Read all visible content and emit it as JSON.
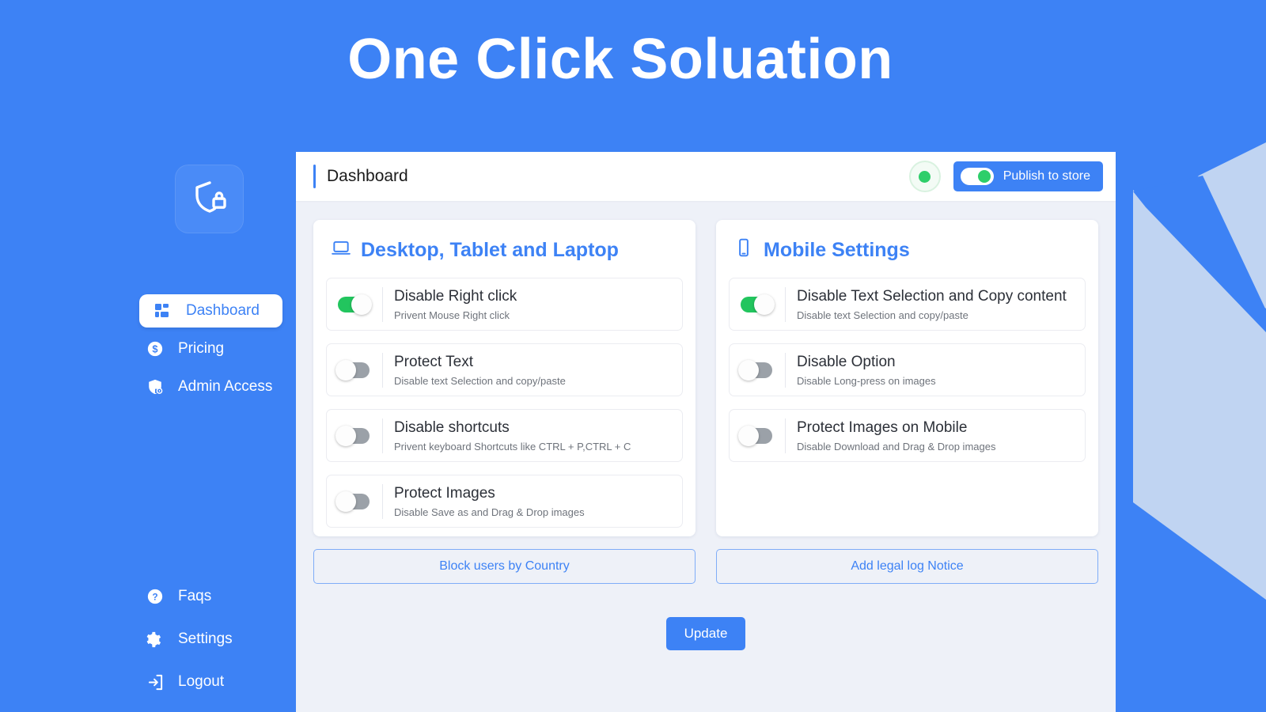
{
  "app": {
    "title": "One Click Soluation",
    "brand_color": "#3d82f5",
    "logo_icon": "shield-lock-icon"
  },
  "sidebar": {
    "top_items": [
      {
        "label": "Dashboard",
        "icon": "dashboard-grid-icon",
        "active": true
      },
      {
        "label": "Pricing",
        "icon": "dollar-circle-icon",
        "active": false
      },
      {
        "label": "Admin Access",
        "icon": "shield-user-icon",
        "active": false
      }
    ],
    "bottom_items": [
      {
        "label": "Faqs",
        "icon": "question-circle-icon"
      },
      {
        "label": "Settings",
        "icon": "gear-icon"
      },
      {
        "label": "Logout",
        "icon": "logout-arrow-icon"
      }
    ]
  },
  "topbar": {
    "title": "Dashboard",
    "status_dot_color": "#2ece6a",
    "publish_label": "Publish to store",
    "publish_toggle_on": true
  },
  "panels": [
    {
      "heading": "Desktop, Tablet and Laptop",
      "icon": "laptop-icon",
      "rows": [
        {
          "title": "Disable Right click",
          "sub": "Privent Mouse Right click",
          "on": true
        },
        {
          "title": "Protect Text",
          "sub": "Disable text Selection and copy/paste",
          "on": false
        },
        {
          "title": "Disable shortcuts",
          "sub": "Privent keyboard Shortcuts like CTRL + P,CTRL + C",
          "on": false
        },
        {
          "title": "Protect Images",
          "sub": "Disable Save as and Drag & Drop images",
          "on": false
        }
      ],
      "action_label": "Block users by Country"
    },
    {
      "heading": "Mobile Settings",
      "icon": "mobile-icon",
      "rows": [
        {
          "title": "Disable Text Selection and Copy content",
          "sub": "Disable text Selection and copy/paste",
          "on": true
        },
        {
          "title": "Disable Option",
          "sub": "Disable Long-press on images",
          "on": false
        },
        {
          "title": "Protect Images on Mobile",
          "sub": "Disable Download and Drag & Drop images",
          "on": false
        }
      ],
      "action_label": "Add legal log Notice"
    }
  ],
  "footer": {
    "update_label": "Update"
  }
}
